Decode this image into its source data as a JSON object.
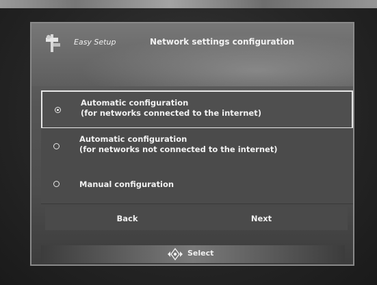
{
  "header": {
    "app_name": "Easy Setup",
    "title": "Network settings configuration",
    "icon": "network-setup-icon"
  },
  "options": [
    {
      "line1": "Automatic configuration",
      "line2": "(for networks connected to the internet)",
      "selected": true
    },
    {
      "line1": "Automatic configuration",
      "line2": "(for networks not connected to the internet)",
      "selected": false
    },
    {
      "line1": "Manual configuration",
      "line2": "",
      "selected": false
    }
  ],
  "buttons": {
    "back": "Back",
    "next": "Next"
  },
  "footer": {
    "hint": "Select",
    "icon": "dpad-icon"
  },
  "colors": {
    "panel": "#555555",
    "selected_border": "#e8e8e8",
    "text": "#f0f0f0"
  }
}
